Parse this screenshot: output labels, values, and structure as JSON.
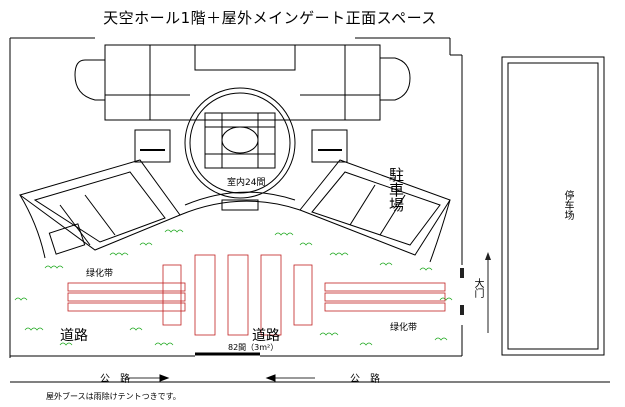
{
  "title": "天空ホール1階＋屋外メインゲート正面スペース",
  "labels": {
    "indoor_booths": "室内24間",
    "parking_lot": "駐車場",
    "parking_lot_right": "停车场",
    "green_belt_left": "绿化带",
    "green_belt_right": "绿化带",
    "road_left": "道路",
    "road_center": "道路",
    "gate": "大门",
    "outdoor_booths": "82間（3m²）",
    "highway_left": "公　路",
    "highway_right": "公　路"
  },
  "footnote": "屋外ブースは雨除けテントつきです。",
  "colors": {
    "line": "#000000",
    "greenery": "#22aa22",
    "tent": "#c02020",
    "gate_mark": "#222222"
  }
}
